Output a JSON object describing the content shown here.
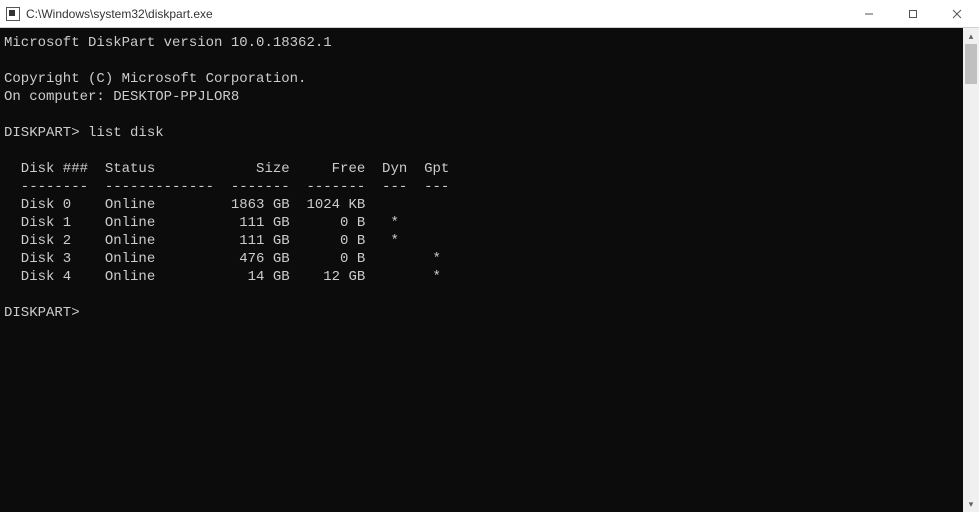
{
  "window": {
    "title": "C:\\Windows\\system32\\diskpart.exe"
  },
  "console": {
    "banner_version": "Microsoft DiskPart version 10.0.18362.1",
    "copyright": "Copyright (C) Microsoft Corporation.",
    "on_computer": "On computer: DESKTOP-PPJLOR8",
    "prompt1": "DISKPART>",
    "command1": "list disk",
    "table": {
      "headers": {
        "disk": "Disk ###",
        "status": "Status",
        "size": "Size",
        "free": "Free",
        "dyn": "Dyn",
        "gpt": "Gpt"
      },
      "separators": {
        "disk": "--------",
        "status": "-------------",
        "size": "-------",
        "free": "-------",
        "dyn": "---",
        "gpt": "---"
      },
      "rows": [
        {
          "disk": "Disk 0",
          "status": "Online",
          "size": "1863 GB",
          "free": "1024 KB",
          "dyn": "",
          "gpt": ""
        },
        {
          "disk": "Disk 1",
          "status": "Online",
          "size": "111 GB",
          "free": "0 B",
          "dyn": "*",
          "gpt": ""
        },
        {
          "disk": "Disk 2",
          "status": "Online",
          "size": "111 GB",
          "free": "0 B",
          "dyn": "*",
          "gpt": ""
        },
        {
          "disk": "Disk 3",
          "status": "Online",
          "size": "476 GB",
          "free": "0 B",
          "dyn": "",
          "gpt": "*"
        },
        {
          "disk": "Disk 4",
          "status": "Online",
          "size": "14 GB",
          "free": "12 GB",
          "dyn": "",
          "gpt": "*"
        }
      ]
    },
    "prompt2": "DISKPART>"
  }
}
